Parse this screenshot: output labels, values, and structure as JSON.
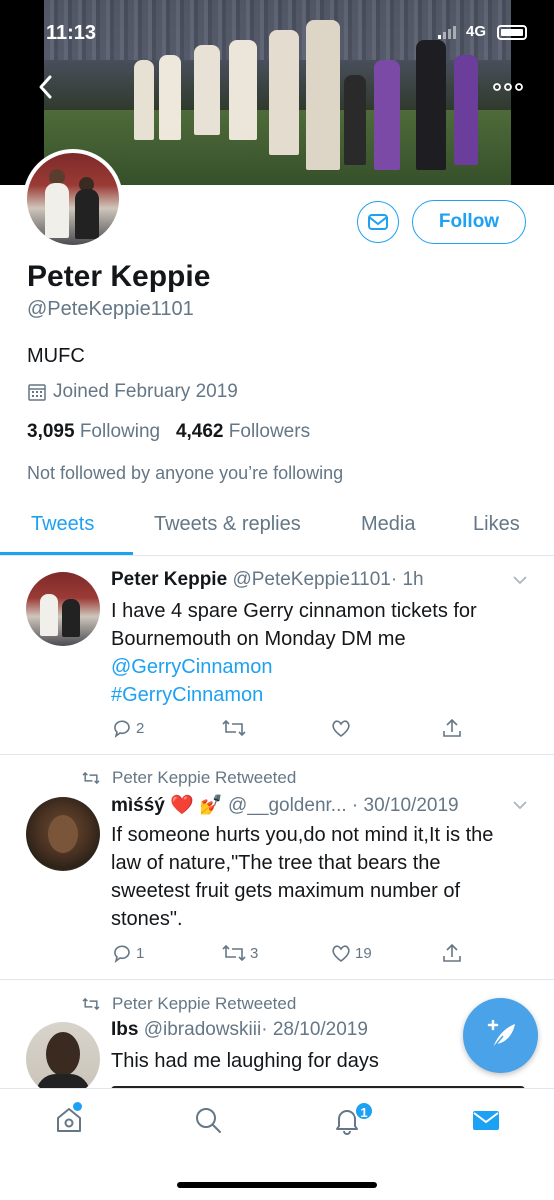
{
  "status_bar": {
    "time": "11:13",
    "network": "4G"
  },
  "profile": {
    "name": "Peter Keppie",
    "handle": "@PeteKeppie1101",
    "bio": "MUFC",
    "joined": "Joined February 2019",
    "following_count": "3,095",
    "following_label": "Following",
    "followers_count": "4,462",
    "followers_label": "Followers",
    "not_followed": "Not followed by anyone you’re following",
    "follow_label": "Follow"
  },
  "tabs": [
    {
      "label": "Tweets",
      "active": true
    },
    {
      "label": "Tweets & replies",
      "active": false
    },
    {
      "label": "Media",
      "active": false
    },
    {
      "label": "Likes",
      "active": false
    }
  ],
  "tweets": [
    {
      "name": "Peter Keppie",
      "handle": "@PeteKeppie1101",
      "time": "· 1h",
      "text": "I have 4 spare Gerry cinnamon tickets for Bournemouth on Monday DM me",
      "mention": "@GerryCinnamon",
      "hashtag": " #GerryCinnamon",
      "replies": "2",
      "retweets": "",
      "likes": ""
    },
    {
      "retweeted_by": "Peter Keppie Retweeted",
      "name": "mìśśý ❤️ 💅",
      "handle": "@__goldenr...",
      "time": "· 30/10/2019",
      "text": "If someone hurts you,do not mind it,It is the law of nature,\"The tree that bears the sweetest fruit gets maximum number of stones\".",
      "replies": "1",
      "retweets": "3",
      "likes": "19"
    },
    {
      "retweeted_by": "Peter Keppie Retweeted",
      "name": "Ibs",
      "handle": "@ibradowskiii",
      "time": "· 28/10/2019",
      "text": "This had me laughing for days"
    }
  ],
  "bottom_nav": {
    "notifications_badge": "1"
  },
  "colors": {
    "accent": "#1da1f2",
    "text": "#14171a",
    "muted": "#657786"
  },
  "icons": [
    "back-arrow-icon",
    "more-icon",
    "mail-icon",
    "calendar-icon",
    "chevron-down-icon",
    "reply-icon",
    "retweet-icon",
    "like-icon",
    "share-icon",
    "compose-tweet-icon",
    "home-icon",
    "search-icon",
    "bell-icon",
    "messages-icon"
  ]
}
